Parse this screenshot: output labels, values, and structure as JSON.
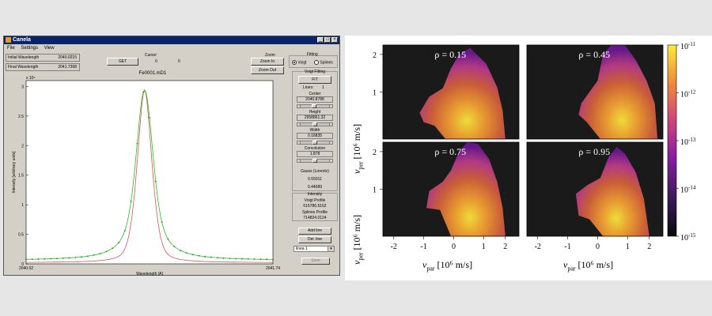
{
  "app": {
    "title": "Canela",
    "menu": [
      "File",
      "Settings",
      "View"
    ],
    "window_controls": [
      "_",
      "□",
      "×"
    ]
  },
  "left_fields": {
    "initial_label": "Initial Wavelength",
    "initial_value": "2040.0215",
    "final_label": "Final Wavelength",
    "final_value": "2041.7398"
  },
  "cursor": {
    "title": "Cursor",
    "get_label": "GET",
    "x_value": "0",
    "y_value": "0"
  },
  "zoom": {
    "title": "Zoom",
    "zoom_in_label": "Zoom In",
    "zoom_out_label": "Zoom Out"
  },
  "fitting": {
    "title": "Fitting",
    "option_voigt": "Voigt",
    "option_splines": "Splines",
    "selected": "Voigt"
  },
  "voigt": {
    "title": "Voigt Fitting",
    "fit_label": "FIT",
    "lines_label": "Lines:",
    "lines_value": "1",
    "center_label": "Center",
    "center_value": "2040.8788",
    "height_label": "Height",
    "height_value": "2958861.32",
    "width_label": "Width",
    "width_value": "0.16835",
    "convolution_label": "Convolution",
    "convolution_value": "1.878",
    "gauss_label": "Gauss (Lorentz)",
    "gauss_value": "0.55911",
    "gauss_value2": "0.44089",
    "slider_positions": [
      0.45,
      0.5,
      0.5,
      0.5
    ]
  },
  "intensity": {
    "title": "Intensity",
    "voigt_profile_label": "Voigt Profile",
    "voigt_profile_value": "616786.5162",
    "splines_profile_label": "Splines Profile",
    "splines_profile_value": "714824.0124"
  },
  "actions": {
    "add_line_label": "Add line",
    "del_line_label": "Del. line",
    "line_select_value": "linea 1",
    "save_label": "Save"
  },
  "plot": {
    "title": "Fe0001.mD1",
    "exponent": "x 10⁶",
    "xlabel": "Wavelength [A]",
    "ylabel": "Intensity [arbitrary units]",
    "xmin_label": "2040.02",
    "xmax_label": "2041.74",
    "ytick_labels": [
      "0",
      "0.5",
      "1",
      "1.5",
      "2",
      "2.5",
      "3"
    ],
    "ylim": [
      0,
      3.1
    ],
    "line_colors": {
      "data": "#1a8a1a",
      "voigt": "#e05050",
      "splines": "#20c020"
    }
  },
  "figure": {
    "xlabel_var": "v",
    "xlabel_sub": "par",
    "xlabel_unit": "[10⁶ m/s]",
    "ylabel_var": "v",
    "ylabel_sub": "per",
    "ylabel_unit": "[10⁶ m/s]",
    "x_ticks": [
      "-2",
      "-1",
      "0",
      "1",
      "2"
    ],
    "y_ticks": [
      "2",
      "1"
    ],
    "panels": [
      {
        "rho": "ρ = 0.15"
      },
      {
        "rho": "ρ = 0.45"
      },
      {
        "rho": "ρ = 0.75"
      },
      {
        "rho": "ρ = 0.95"
      }
    ],
    "colorbar_ticks": [
      {
        "mant": "10",
        "exp": "-11"
      },
      {
        "mant": "10",
        "exp": "-12"
      },
      {
        "mant": "10",
        "exp": "-13"
      },
      {
        "mant": "10",
        "exp": "-14"
      },
      {
        "mant": "10",
        "exp": "-15"
      }
    ],
    "colors": {
      "background": "#1a1a1a",
      "low": "#7a1a9a",
      "mid": "#d24a6a",
      "high": "#f5e23a"
    }
  }
}
